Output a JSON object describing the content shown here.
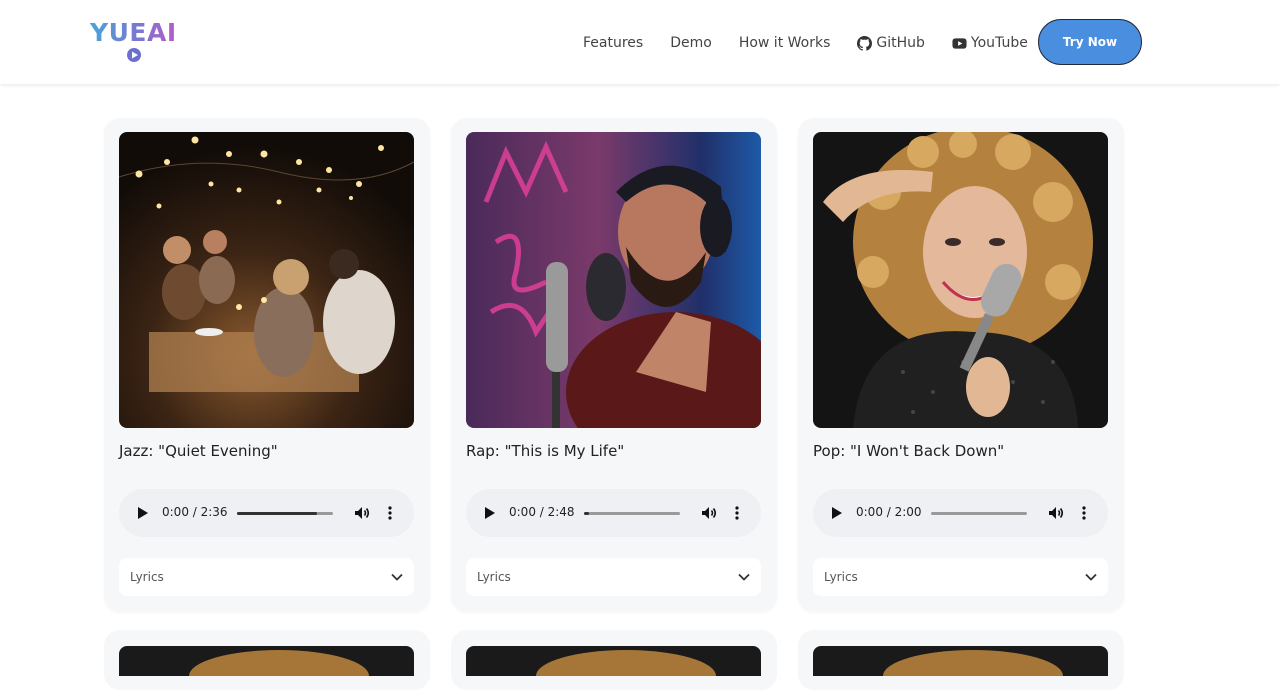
{
  "brand": {
    "name": "YUEAI"
  },
  "nav": {
    "items": [
      {
        "label": "Features",
        "icon": ""
      },
      {
        "label": "Demo",
        "icon": ""
      },
      {
        "label": "How it Works",
        "icon": ""
      },
      {
        "label": "GitHub",
        "icon": "github-icon"
      },
      {
        "label": "YouTube",
        "icon": "youtube-icon"
      }
    ],
    "cta": "Try Now"
  },
  "cards": [
    {
      "title": "Jazz: \"Quiet Evening\"",
      "time": "0:00 / 2:36",
      "progress": 0.83,
      "lyrics_label": "Lyrics"
    },
    {
      "title": "Rap: \"This is My Life\"",
      "time": "0:00 / 2:48",
      "progress": 0.05,
      "lyrics_label": "Lyrics"
    },
    {
      "title": "Pop: \"I Won't Back Down\"",
      "time": "0:00 / 2:00",
      "progress": 0.0,
      "lyrics_label": "Lyrics"
    }
  ],
  "colors": {
    "accent": "#4a8ee0",
    "card_bg": "#f6f7f9"
  }
}
